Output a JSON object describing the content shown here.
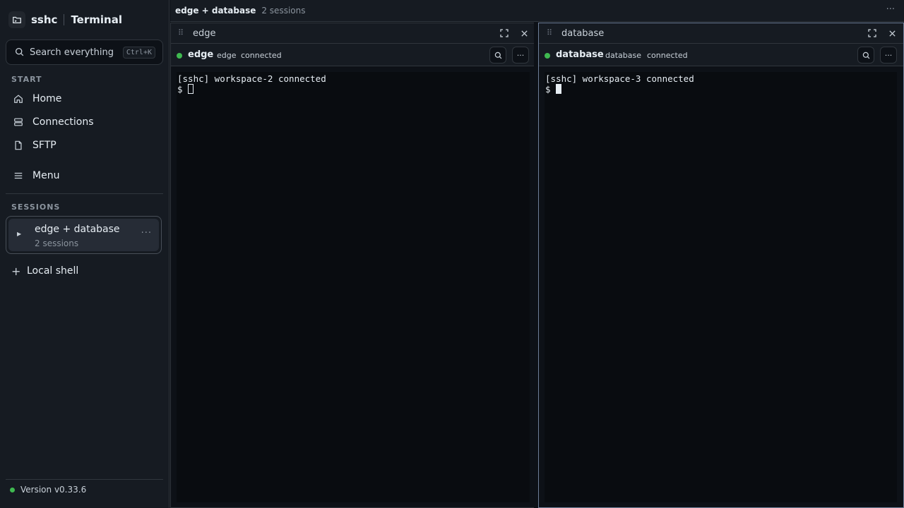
{
  "sidebar": {
    "brand_name": "sshc",
    "brand_title": "Terminal",
    "search_placeholder": "Search everything",
    "search_shortcut": "Ctrl+K",
    "start_label": "START",
    "nav": [
      {
        "label": "Home",
        "icon": "home-icon"
      },
      {
        "label": "Connections",
        "icon": "server-icon"
      },
      {
        "label": "SFTP",
        "icon": "file-icon"
      },
      {
        "label": "Menu",
        "icon": "hamburger-icon"
      }
    ],
    "sessions_label": "SESSIONS",
    "session": {
      "name": "edge + database",
      "sub": "2 sessions",
      "more": "···"
    },
    "local_shell": "Local shell",
    "version": "Version v0.33.6"
  },
  "topbar": {
    "title": "edge + database",
    "sub": "2 sessions",
    "more": "···"
  },
  "panes": [
    {
      "title": "edge",
      "status_name": "edge",
      "status_host": "edge",
      "status_state": "connected",
      "lines": [
        "[sshc] workspace-2 connected",
        "$"
      ]
    },
    {
      "title": "database",
      "status_name": "database",
      "status_host": "database",
      "status_state": "connected",
      "lines": [
        "[sshc] workspace-3 connected",
        "$"
      ]
    }
  ],
  "colors": {
    "accent_green": "#3fb950",
    "background": "#0d1117",
    "sidebar": "#161b22"
  }
}
